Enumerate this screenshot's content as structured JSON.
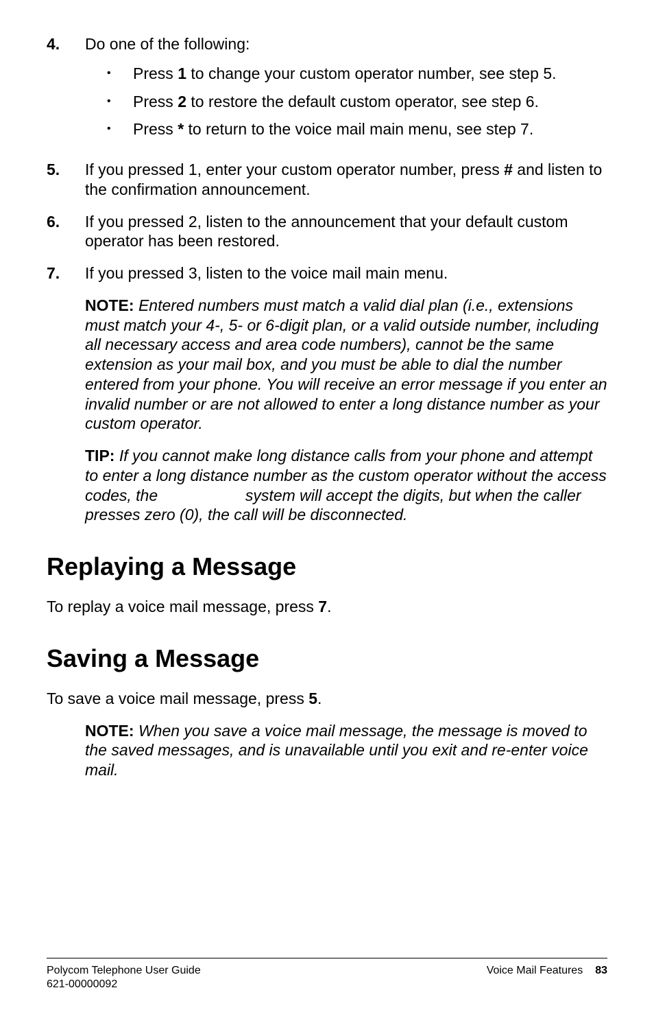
{
  "item4": {
    "num": "4.",
    "text": "Do one of the following:",
    "bullets": [
      {
        "pre": "Press ",
        "key": "1",
        "post": " to change your custom operator number, see step 5."
      },
      {
        "pre": "Press ",
        "key": "2",
        "post": " to restore the default custom operator, see step 6."
      },
      {
        "pre": "Press ",
        "key": "*",
        "post": " to return to the voice mail main menu, see step 7."
      }
    ]
  },
  "item5": {
    "num": "5.",
    "pre": "If you pressed 1, enter your custom operator number, press ",
    "key": "#",
    "post": " and listen to the confirmation announcement."
  },
  "item6": {
    "num": "6.",
    "text": "If you pressed 2, listen to the announcement that your default custom operator has been restored."
  },
  "item7": {
    "num": "7.",
    "text": "If you pressed 3, listen to the voice mail main menu."
  },
  "note1": {
    "label": "NOTE:",
    "text": " Entered numbers must match a valid dial plan (i.e., extensions must match your 4-, 5- or 6-digit plan, or a valid outside number, including all necessary access and area code numbers), cannot be the same extension as your mail box, and you must be able to dial the number entered from your phone. You will receive an error message if you enter an invalid number or are not allowed to enter a long distance number as your custom operator."
  },
  "tip1": {
    "label": "TIP:",
    "text": " If you cannot make long distance calls from your phone and attempt to enter a long distance number as the custom operator without the access codes, the                    system will accept the digits, but when the caller presses zero (0), the call will be disconnected."
  },
  "heading_replay": "Replaying a Message",
  "replay": {
    "pre": "To replay a voice mail message, press ",
    "key": "7",
    "post": "."
  },
  "heading_save": "Saving a Message",
  "save": {
    "pre": "To save a voice mail message, press ",
    "key": "5",
    "post": "."
  },
  "note2": {
    "label": "NOTE:",
    "text": " When you save a voice mail message, the message is moved to the saved messages, and is unavailable until you exit and re-enter voice mail."
  },
  "footer": {
    "left1": "Polycom Telephone User Guide",
    "left2": "621-00000092",
    "right_label": "Voice Mail Features",
    "page": "83"
  }
}
